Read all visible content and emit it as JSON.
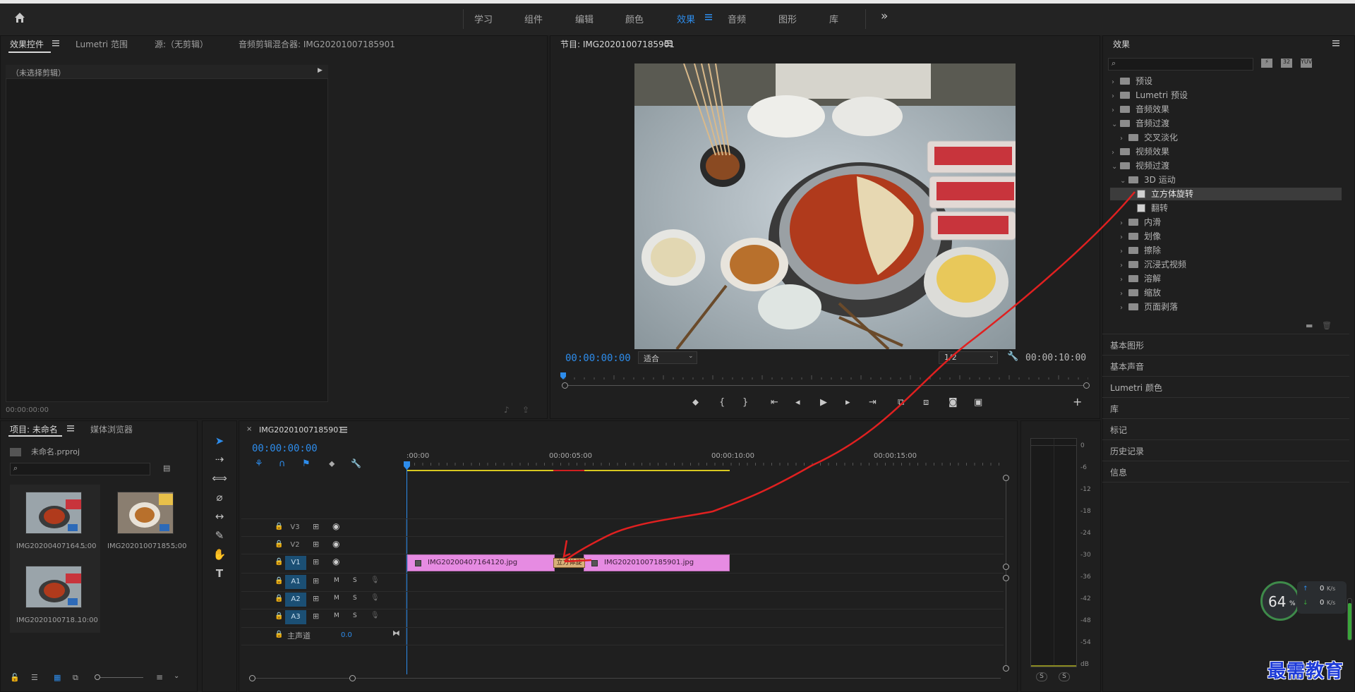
{
  "workspace": {
    "tabs": [
      "学习",
      "组件",
      "编辑",
      "颜色",
      "效果",
      "音频",
      "图形",
      "库"
    ],
    "active_tab": "效果",
    "more": "»"
  },
  "source_panel": {
    "tabs": [
      "效果控件",
      "Lumetri 范围",
      "源:（无剪辑）",
      "音频剪辑混合器: IMG20201007185901"
    ],
    "no_clip": "（未选择剪辑）",
    "timecode": "00:00:00:00"
  },
  "program": {
    "title": "节目: IMG20201007185901",
    "timecode": "00:00:00:00",
    "fit": "适合",
    "resolution": "1/2",
    "duration": "00:00:10:00",
    "playhead_fraction": 0.0
  },
  "effects": {
    "title": "效果",
    "search_placeholder": "",
    "tree": [
      {
        "label": "预设",
        "expanded": false,
        "depth": 0,
        "kind": "folder"
      },
      {
        "label": "Lumetri 预设",
        "expanded": false,
        "depth": 0,
        "kind": "folder"
      },
      {
        "label": "音频效果",
        "expanded": false,
        "depth": 0,
        "kind": "folder"
      },
      {
        "label": "音频过渡",
        "expanded": true,
        "depth": 0,
        "kind": "folder"
      },
      {
        "label": "交叉淡化",
        "expanded": false,
        "depth": 1,
        "kind": "folder"
      },
      {
        "label": "视频效果",
        "expanded": false,
        "depth": 0,
        "kind": "folder"
      },
      {
        "label": "视频过渡",
        "expanded": true,
        "depth": 0,
        "kind": "folder"
      },
      {
        "label": "3D 运动",
        "expanded": true,
        "depth": 1,
        "kind": "folder"
      },
      {
        "label": "立方体旋转",
        "depth": 2,
        "kind": "effect",
        "selected": true
      },
      {
        "label": "翻转",
        "depth": 2,
        "kind": "effect"
      },
      {
        "label": "内滑",
        "expanded": false,
        "depth": 1,
        "kind": "folder"
      },
      {
        "label": "划像",
        "expanded": false,
        "depth": 1,
        "kind": "folder"
      },
      {
        "label": "擦除",
        "expanded": false,
        "depth": 1,
        "kind": "folder"
      },
      {
        "label": "沉浸式视频",
        "expanded": false,
        "depth": 1,
        "kind": "folder"
      },
      {
        "label": "溶解",
        "expanded": false,
        "depth": 1,
        "kind": "folder"
      },
      {
        "label": "缩放",
        "expanded": false,
        "depth": 1,
        "kind": "folder"
      },
      {
        "label": "页面剥落",
        "expanded": false,
        "depth": 1,
        "kind": "folder"
      }
    ],
    "sections": [
      "基本图形",
      "基本声音",
      "Lumetri 颜色",
      "库",
      "标记",
      "历史记录",
      "信息"
    ]
  },
  "project": {
    "tabs": [
      "项目: 未命名",
      "媒体浏览器"
    ],
    "file": "未命名.prproj",
    "items": [
      {
        "name": "IMG20200407164...",
        "duration": "5:00"
      },
      {
        "name": "IMG20201007185...",
        "duration": "5:00"
      },
      {
        "name": "IMG2020100718...",
        "duration": "10:00"
      }
    ]
  },
  "timeline": {
    "title": "IMG20201007185901",
    "timecode": "00:00:00:00",
    "ruler": [
      ":00:00",
      "00:00:05:00",
      "00:00:10:00",
      "00:00:15:00"
    ],
    "video_tracks": [
      "V3",
      "V2",
      "V1"
    ],
    "audio_tracks": [
      "A1",
      "A2",
      "A3"
    ],
    "master": {
      "label": "主声道",
      "value": "0.0"
    },
    "clips": [
      {
        "name": "IMG20200407164120.jpg"
      },
      {
        "name": "IMG20201007185901.jpg"
      }
    ],
    "transition": "立方体旋"
  },
  "meter": {
    "scale": [
      "0",
      "-6",
      "-12",
      "-18",
      "-24",
      "-30",
      "-36",
      "-42",
      "-48",
      "-54",
      "dB"
    ],
    "solo": [
      "S",
      "S"
    ]
  },
  "network_widget": {
    "percent": "64",
    "pct_sign": "%",
    "up": "0",
    "down": "0",
    "unit": "K/s"
  },
  "watermark": "最需教育",
  "colors": {
    "accent": "#2d8ceb",
    "clip": "#e68be2",
    "annotation": "#e02020"
  }
}
